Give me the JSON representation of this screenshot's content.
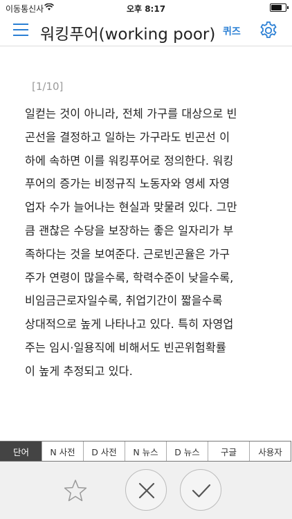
{
  "status_bar": {
    "carrier": "이동통신사",
    "time": "오후 8:17",
    "battery_level": 0.85
  },
  "nav": {
    "title": "워킹푸어(working poor)",
    "quiz_label": "퀴즈",
    "menu_icon": "hamburger-menu-icon",
    "settings_icon": "gear-icon"
  },
  "content": {
    "page_indicator": "[1/10]",
    "text": "일컫는 것이 아니라, 전체 가구를 대상으로 빈\n곤선을 결정하고 일하는 가구라도 빈곤선 이\n하에 속하면 이를 워킹푸어로 정의한다. 워킹\n푸어의 증가는 비정규직 노동자와 영세 자영\n업자 수가 늘어나는 현실과 맞물려 있다. 그만\n큼 괜찮은 수당을 보장하는 좋은 일자리가 부\n족하다는 것을 보여준다. 근로빈곤율은 가구\n주가 연령이 많을수록, 학력수준이 낮을수록,\n비임금근로자일수록,  취업기간이  짧을수록\n상대적으로 높게 나타나고 있다. 특히 자영업\n주는 임시·일용직에 비해서도 빈곤위험확률\n이 높게 추정되고 있다."
  },
  "tabs": [
    {
      "label": "단어",
      "active": true
    },
    {
      "label": "N 사전",
      "active": false
    },
    {
      "label": "D 사전",
      "active": false
    },
    {
      "label": "N 뉴스",
      "active": false
    },
    {
      "label": "D 뉴스",
      "active": false
    },
    {
      "label": "구글",
      "active": false
    },
    {
      "label": "사용자",
      "active": false
    }
  ],
  "actions": {
    "star_icon": "star-outline-icon",
    "close_icon": "close-icon",
    "check_icon": "checkmark-icon"
  },
  "colors": {
    "accent": "#2a7fd4",
    "active_tab": "#444444",
    "bottom_bar": "#f0f0f0"
  }
}
